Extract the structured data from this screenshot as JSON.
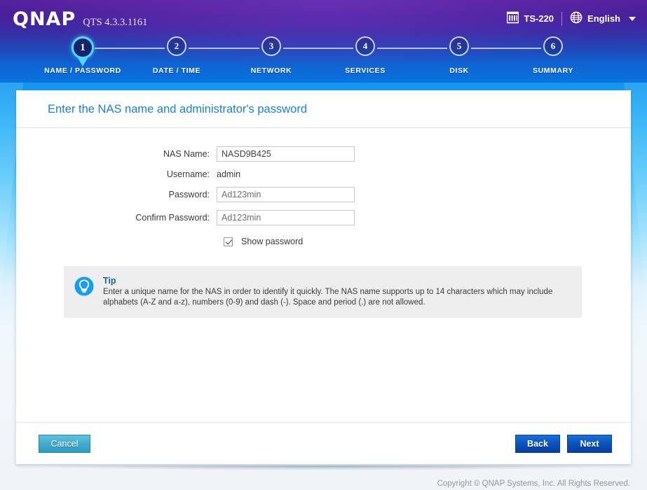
{
  "header": {
    "logo_text": "QNAP",
    "version_text": "QTS 4.3.3.1161",
    "model": "TS-220",
    "model_icon": "nas-device-icon",
    "language": "English",
    "language_icon": "globe-icon",
    "dropdown_icon": "chevron-down-icon"
  },
  "steps": [
    {
      "number": "1",
      "label": "NAME / PASSWORD",
      "active": true
    },
    {
      "number": "2",
      "label": "DATE / TIME",
      "active": false
    },
    {
      "number": "3",
      "label": "NETWORK",
      "active": false
    },
    {
      "number": "4",
      "label": "SERVICES",
      "active": false
    },
    {
      "number": "5",
      "label": "DISK",
      "active": false
    },
    {
      "number": "6",
      "label": "SUMMARY",
      "active": false
    }
  ],
  "panel": {
    "title": "Enter the NAS name and administrator's password"
  },
  "form": {
    "nas_name_label": "NAS Name:",
    "nas_name_value": "NASD9B425",
    "username_label": "Username:",
    "username_value": "admin",
    "password_label": "Password:",
    "password_value": "Ad123min",
    "confirm_password_label": "Confirm Password:",
    "confirm_password_value": "Ad123min",
    "show_password_label": "Show password",
    "show_password_checked": true
  },
  "tip": {
    "icon": "lightbulb-icon",
    "title": "Tip",
    "body": "Enter a unique name for the NAS in order to identify it quickly. The NAS name supports up to 14 characters which may include alphabets (A-Z and a-z), numbers (0-9) and dash (-). Space and period (.) are not allowed."
  },
  "buttons": {
    "cancel": "Cancel",
    "back": "Back",
    "next": "Next"
  },
  "footer": {
    "copyright": "Copyright © QNAP Systems, Inc. All Rights Reserved."
  },
  "colors": {
    "accent_blue": "#1b7fd4",
    "active_step_ring": "#4fd8ff",
    "header_purple": "#55219c",
    "tip_bg": "#eeeeee",
    "next_button": "#0b54bf",
    "cancel_button": "#43aacd"
  }
}
